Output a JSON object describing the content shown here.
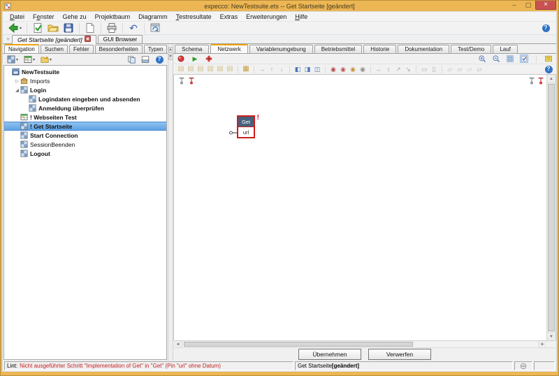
{
  "window": {
    "title": "expecco: NewTestsuite.ets -- Get Startseite [geändert]",
    "controls": {
      "minimize": "–",
      "maximize": "▢",
      "close": "×"
    }
  },
  "menubar": {
    "items": [
      {
        "label": "Datei",
        "u": 0
      },
      {
        "label": "Fenster",
        "u": 1
      },
      {
        "label": "Gehe zu",
        "u": -1
      },
      {
        "label": "Projektbaum",
        "u": -1
      },
      {
        "label": "Diagramm",
        "u": -1
      },
      {
        "label": "Testresultate",
        "u": 0
      },
      {
        "label": "Extras",
        "u": -1
      },
      {
        "label": "Erweiterungen",
        "u": -1
      },
      {
        "label": "Hilfe",
        "u": 0
      }
    ]
  },
  "main_toolbar": {
    "groups": [
      [
        "back"
      ],
      [
        "check-page",
        "open-folder",
        "save"
      ],
      [
        "new-page"
      ],
      [
        "print"
      ],
      [
        "undo"
      ],
      [
        "window-tool"
      ]
    ],
    "dropdowns": [
      "back"
    ]
  },
  "doc_tabs": [
    {
      "label": "Get Startseite [geändert]",
      "active": true,
      "closable": true
    },
    {
      "label": "GUI Browser",
      "active": false,
      "closable": false
    }
  ],
  "left_panel": {
    "tabs": [
      "Navigation",
      "Suchen",
      "Fehler",
      "Besonderheiten",
      "Typen"
    ],
    "active_tab": 0,
    "toolbar": {
      "left": [
        "add-action-menu",
        "add-table-menu",
        "add-folder-menu"
      ],
      "right": [
        "copy",
        "split",
        "help"
      ]
    },
    "tree": [
      {
        "label": "NewTestsuite",
        "level": 0,
        "bold": true,
        "icon": "suite",
        "expander": "none"
      },
      {
        "label": "Imports",
        "level": 1,
        "bold": false,
        "icon": "imports",
        "expander": "collapsed"
      },
      {
        "label": "Login",
        "level": 1,
        "bold": true,
        "icon": "action",
        "expander": "expanded"
      },
      {
        "label": "Logindaten eingeben und absenden",
        "level": 2,
        "bold": true,
        "icon": "action",
        "expander": "none"
      },
      {
        "label": "Anmeldung überprüfen",
        "level": 2,
        "bold": true,
        "icon": "action",
        "expander": "none"
      },
      {
        "label": "! Webseiten Test",
        "level": 1,
        "bold": true,
        "icon": "table",
        "expander": "none"
      },
      {
        "label": "! Get Startseite",
        "level": 1,
        "bold": true,
        "icon": "action",
        "expander": "none",
        "selected": true
      },
      {
        "label": "Start Connection",
        "level": 1,
        "bold": true,
        "icon": "action",
        "expander": "none"
      },
      {
        "label": "SessionBeenden",
        "level": 1,
        "bold": false,
        "icon": "action",
        "expander": "none"
      },
      {
        "label": "Logout",
        "level": 1,
        "bold": true,
        "icon": "action",
        "expander": "none"
      }
    ]
  },
  "right_panel": {
    "tabs": [
      "Schema",
      "Netzwerk",
      "Variablenumgebung",
      "Betriebsmittel",
      "Historie",
      "Dokumentation",
      "Test/Demo",
      "Lauf"
    ],
    "active_tab": 1,
    "run_toolbar": {
      "left": [
        "record",
        "play",
        "debug"
      ],
      "right": [
        "zoom-in",
        "zoom-out",
        "grid",
        "check-on"
      ],
      "far_right": [
        "note"
      ]
    },
    "edit_toolbar": {
      "groups": [
        [
          "block-1",
          "block-2",
          "block-3",
          "block-4",
          "block-5",
          "block-6"
        ],
        [
          "block-active"
        ],
        [
          "arrow-right",
          "arrow-up",
          "arrow-down"
        ],
        [
          "pin-left",
          "pin-mid",
          "pin-right"
        ],
        [
          "conn-1",
          "conn-2",
          "conn-3",
          "conn-4"
        ],
        [
          "link-1",
          "link-2",
          "link-3",
          "link-4"
        ],
        [
          "align-1",
          "align-2"
        ],
        [
          "route-1",
          "route-2",
          "route-3",
          "route-4"
        ]
      ],
      "far_right": [
        "help"
      ]
    },
    "canvas": {
      "node": {
        "title": "Get",
        "pin_label": "url",
        "warning": "!"
      },
      "corner_pins": [
        "pin-gray",
        "pin-red"
      ]
    },
    "apply_label": "Übernehmen",
    "discard_label": "Verwerfen"
  },
  "statusbar": {
    "lint_label": "Lint:",
    "lint_message": "Nicht ausgeführter Schritt \"Implementation of Get\" in \"Get\" (Pin \"url\" ohne Datum)",
    "doc_name": "Get Startseite ",
    "doc_state": "[geändert]"
  },
  "colors": {
    "frame": "#ecb654",
    "tab_accent": "#f0a30b",
    "selection": "#6fb0ec",
    "node_header": "#45617c",
    "alert_red": "#cf1d1d",
    "lint_red": "#c42222",
    "play_green": "#2f9e2f"
  }
}
